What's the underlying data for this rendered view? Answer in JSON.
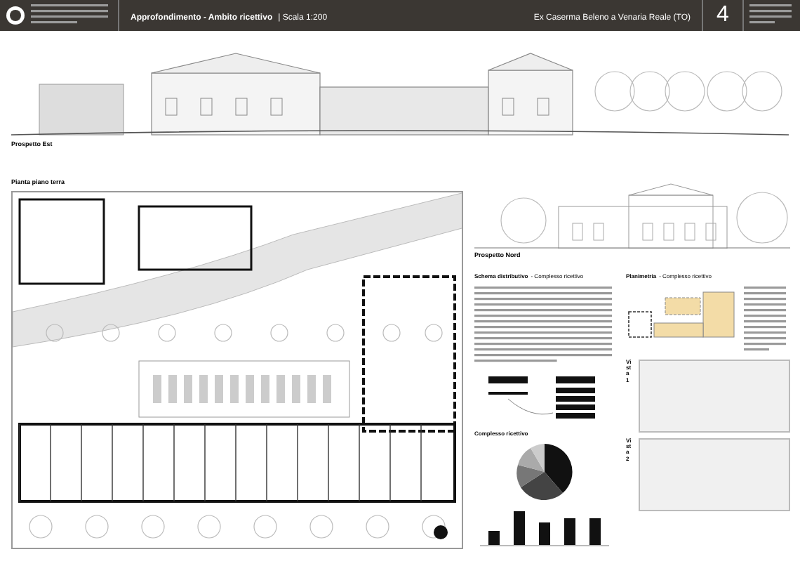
{
  "header": {
    "title": "Approfondimento - Ambito ricettivo",
    "scale": "| Scala 1:200",
    "location": "Ex Caserma Beleno a Venaria Reale (TO)",
    "board_number": "4"
  },
  "top_elevation": {
    "caption": "Prospetto Est"
  },
  "plan": {
    "caption": "Pianta piano terra"
  },
  "north_elevation": {
    "caption": "Prospetto Nord"
  },
  "schema": {
    "title": "Schema distributivo",
    "subtitle": "- Complesso ricettivo"
  },
  "planimetria": {
    "title": "Planimetria",
    "subtitle": "- Complesso ricettivo"
  },
  "pie": {
    "title": "Complesso ricettivo"
  },
  "views": [
    {
      "label": "Vista 1"
    },
    {
      "label": "Vista 2"
    }
  ]
}
